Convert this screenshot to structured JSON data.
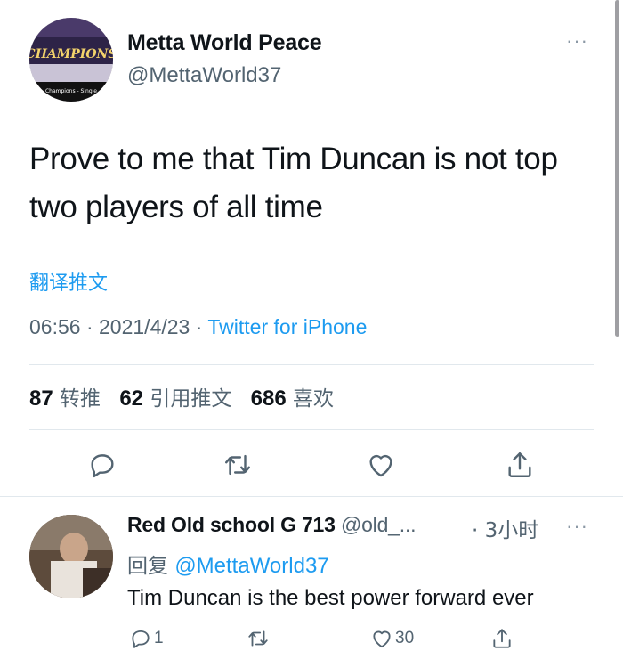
{
  "tweet": {
    "name": "Metta World Peace",
    "handle": "@MettaWorld37",
    "avatar_text": "CHAMPIONS",
    "avatar_caption": "Champions - Single",
    "more": "···",
    "text": "Prove to me that Tim Duncan is not top two players of all time",
    "translate": "翻译推文",
    "time": "06:56",
    "dot": "·",
    "date": "2021/4/23",
    "source": "Twitter for iPhone",
    "stats": {
      "retweets": "87",
      "retweets_label": "转推",
      "quotes": "62",
      "quotes_label": "引用推文",
      "likes": "686",
      "likes_label": "喜欢"
    },
    "icons": [
      "reply-icon",
      "retweet-icon",
      "like-icon",
      "share-icon"
    ]
  },
  "reply": {
    "name": "Red Old school G 713",
    "handle": "@old_...",
    "time": "· 3小时",
    "more": "···",
    "replying_label": "回复",
    "replying_to": "@MettaWorld37",
    "text": "Tim Duncan is the best power forward ever",
    "reply_count": "1",
    "like_count": "30"
  },
  "colors": {
    "accent": "#1d9bf0",
    "secondary_text": "#536471",
    "divider": "#e1e8ed"
  }
}
